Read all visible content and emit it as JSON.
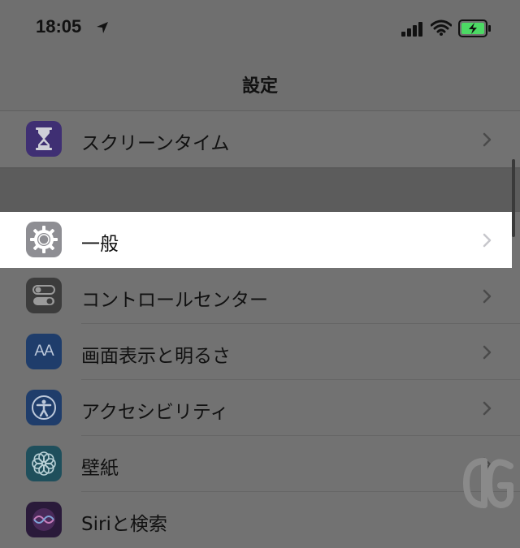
{
  "status": {
    "time": "18:05",
    "location_icon": "location-arrow-icon",
    "signal_icon": "cellular-signal-icon",
    "wifi_icon": "wifi-icon",
    "battery_icon": "battery-charging-icon"
  },
  "nav": {
    "title": "設定"
  },
  "items": [
    {
      "label": "スクリーンタイム",
      "icon": "hourglass-icon",
      "color": "#3f2f73"
    },
    {
      "label": "一般",
      "icon": "gear-icon",
      "color": "#8e8e93"
    },
    {
      "label": "コントロールセンター",
      "icon": "toggle-switches-icon",
      "color": "#3c3c3c"
    },
    {
      "label": "画面表示と明るさ",
      "icon": "text-size-icon",
      "color": "#1f3d6b"
    },
    {
      "label": "アクセシビリティ",
      "icon": "accessibility-icon",
      "color": "#1f3d6b"
    },
    {
      "label": "壁紙",
      "icon": "flower-icon",
      "color": "#1f4f5c"
    },
    {
      "label": "Siriと検索",
      "icon": "siri-icon",
      "color": "#2a1a3a"
    }
  ],
  "icon_text": {
    "text_size": "AA"
  },
  "colors": {
    "highlight": "#ffffff",
    "battery_green": "#4cd964"
  }
}
